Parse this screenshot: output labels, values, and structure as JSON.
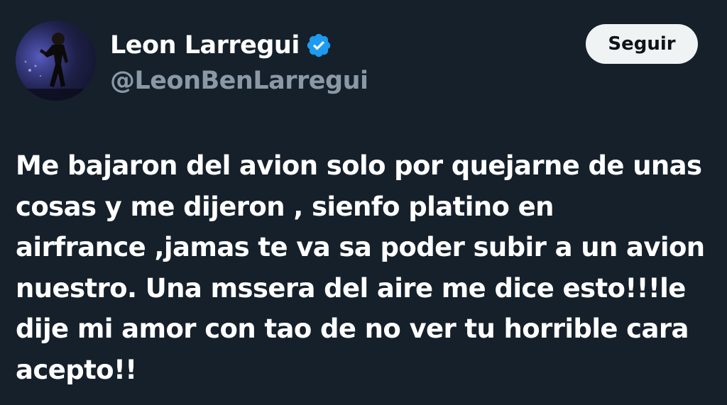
{
  "author": {
    "display_name": "Leon Larregui",
    "handle": "@LeonBenLarregui",
    "verified": true,
    "verified_icon": "verified-badge-icon",
    "verified_color": "#1d9bf0",
    "avatar": "avatar-photo-performer-on-stage"
  },
  "actions": {
    "follow_label": "Seguir"
  },
  "tweet": {
    "lines": [
      "Me bajaron del avion solo por quejarne de unas",
      "cosas y me dijeron , sienfo platino en",
      "airfrance ,jamas te va sa poder subir a un avion",
      "nuestro. Una mssera del aire me dice esto!!!le",
      "dije mi amor con tao de no ver tu horrible cara",
      "acepto!!"
    ]
  },
  "colors": {
    "background": "#15202b",
    "text_primary": "#ffffff",
    "text_secondary": "#8b98a5",
    "button_bg": "#eff3f4",
    "button_text": "#0f1419"
  }
}
